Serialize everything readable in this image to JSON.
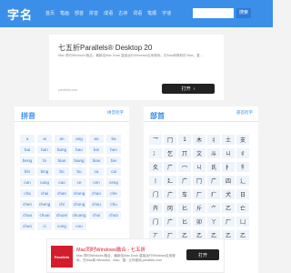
{
  "header": {
    "logo": "字名",
    "nav": [
      "首页",
      "笔画",
      "部首",
      "拼音",
      "成语",
      "古诗",
      "词语",
      "笔顺",
      "字谜"
    ],
    "search_placeholder": "",
    "search_button": "搜索"
  },
  "ad": {
    "title": "七五折Parallels® Desktop 20",
    "desc": "Mac 同时Windows 融合。最新给Mac Dock 直接运行Windows应用程序。在Mac和微软的 Mac、复...",
    "source": "parallels.com",
    "button": "打开",
    "button_icon": "chevron-right"
  },
  "pinyin_panel": {
    "title": "拼音",
    "link": "拼音检字",
    "items": [
      "a",
      "ai",
      "an",
      "ang",
      "ao",
      "ba",
      "bai",
      "ban",
      "bang",
      "bao",
      "bei",
      "ben",
      "beng",
      "bi",
      "bian",
      "biang",
      "biao",
      "bie",
      "bin",
      "bing",
      "bo",
      "bu",
      "ca",
      "cai",
      "can",
      "cang",
      "cao",
      "ce",
      "cen",
      "ceng",
      "cha",
      "chai",
      "chan",
      "chang",
      "chao",
      "che",
      "chen",
      "cheng",
      "chi",
      "chong",
      "chou",
      "chu",
      "chua",
      "chuai",
      "chuan",
      "chuang",
      "chui",
      "chun",
      "chuo",
      "ci",
      "cong",
      "cou"
    ]
  },
  "radical_panel": {
    "title": "部首",
    "link": "部首检字",
    "items": [
      "乛",
      "冂",
      "1",
      "木",
      "丬",
      "土",
      "支",
      "冫",
      "乞",
      "丌",
      "文",
      "斗",
      "ㄐ",
      "彳",
      "夂",
      "广",
      "冖",
      "ㄐ",
      "氏",
      "扌",
      "牜",
      "丨",
      "廴",
      "广",
      "冂",
      "广",
      "四",
      "辶",
      "门",
      "广",
      "车",
      "厂",
      "疒",
      "犬",
      "日",
      "卉",
      "冈",
      "匕",
      "斤",
      "⺈",
      "乙",
      "亡",
      "门",
      "广",
      "匕",
      "卯",
      "丫",
      "厂",
      "凵",
      "丆",
      "厂",
      "乙",
      "乙",
      "乙",
      "乙",
      "乙"
    ]
  },
  "bottom_ad": {
    "logo": "Parallels",
    "title": "Mac同时Windows融合 - 七五折",
    "desc": "Mac 同时Windows 融合，最新给Mac Dock 直接运行Windows应用程序。在Mac和 Windows、Mac、复...让你使用 parallels.com",
    "button": "打开"
  },
  "colors": {
    "brand": "#3b8fe8",
    "cell_bg": "#eef4fc"
  }
}
